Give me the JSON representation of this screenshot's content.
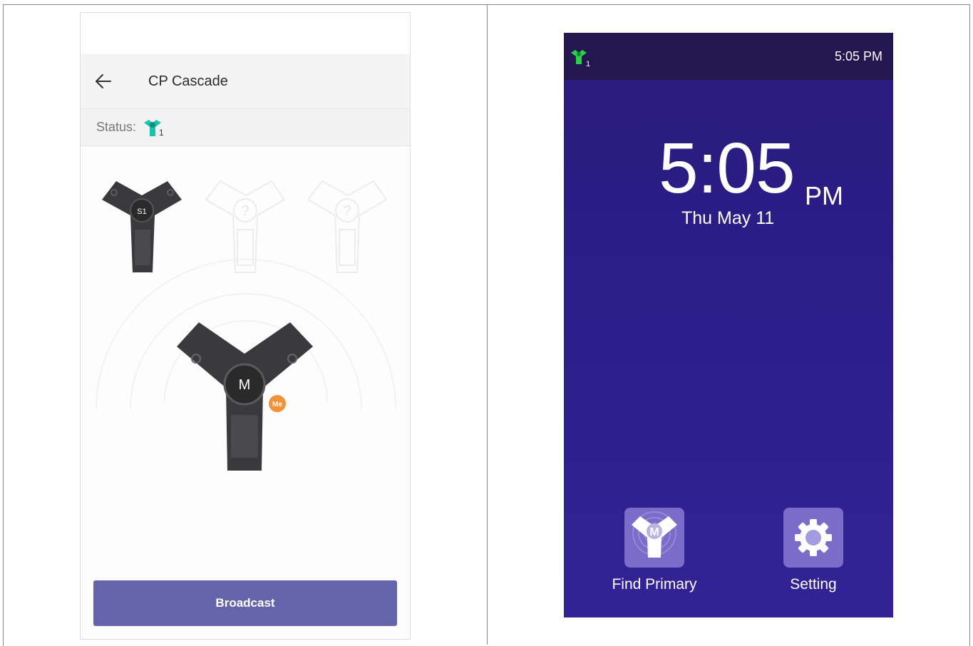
{
  "left": {
    "header": {
      "title": "CP Cascade"
    },
    "status": {
      "label": "Status:",
      "count": "1"
    },
    "devices": {
      "slave1": "S1",
      "unknown": "?",
      "master": "M",
      "me_badge": "Me"
    },
    "broadcast_label": "Broadcast"
  },
  "right": {
    "status_bar": {
      "time": "5:05 PM",
      "cascade_count": "1"
    },
    "clock": {
      "time": "5:05",
      "ampm": "PM",
      "date": "Thu May 11"
    },
    "apps": [
      {
        "label": "Find Primary",
        "icon": "find-primary-icon",
        "badge": "M"
      },
      {
        "label": "Setting",
        "icon": "gear-icon"
      }
    ]
  },
  "colors": {
    "accent": "#6364a9",
    "status_teal": "#19c3ae",
    "status_green": "#28d14a",
    "me_orange": "#f0923a",
    "device_bg": "#2c1d86"
  }
}
